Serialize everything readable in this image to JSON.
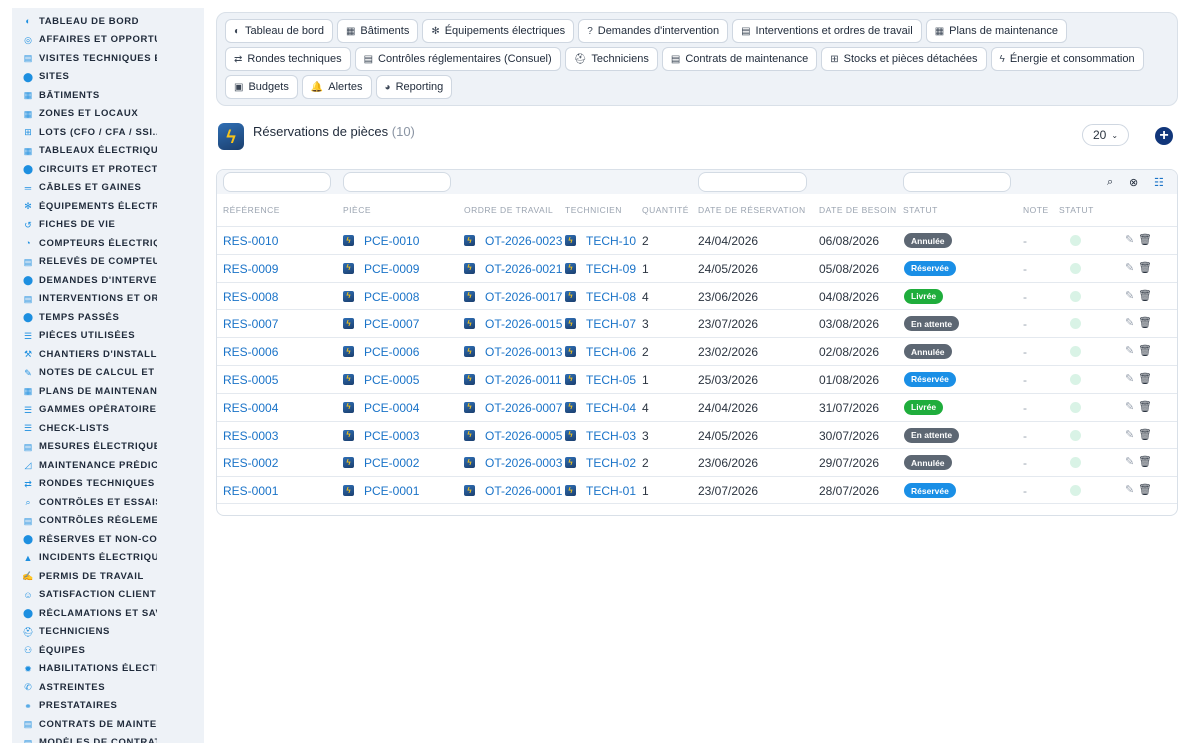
{
  "sidebar": {
    "items": [
      {
        "label": "TABLEAU DE BORD",
        "icon": "dashboard-icon",
        "glyph": "◐"
      },
      {
        "label": "AFFAIRES ET OPPORTUNITÉS",
        "icon": "target-icon",
        "glyph": "◎"
      },
      {
        "label": "VISITES TECHNIQUES ET AUDITS",
        "icon": "clipboard-icon",
        "glyph": "▤"
      },
      {
        "label": "SITES",
        "icon": "map-pin-icon",
        "glyph": "⬤"
      },
      {
        "label": "BÂTIMENTS",
        "icon": "building-icon",
        "glyph": "▦"
      },
      {
        "label": "ZONES ET LOCAUX",
        "icon": "grid-icon",
        "glyph": "▦"
      },
      {
        "label": "LOTS (CFO / CFA / SSI...)",
        "icon": "sitemap-icon",
        "glyph": "⊞"
      },
      {
        "label": "TABLEAUX ÉLECTRIQUES",
        "icon": "panel-icon",
        "glyph": "▦"
      },
      {
        "label": "CIRCUITS ET PROTECTIONS",
        "icon": "circuit-icon",
        "glyph": "⬤"
      },
      {
        "label": "CÂBLES ET GAINES",
        "icon": "cable-icon",
        "glyph": "═"
      },
      {
        "label": "ÉQUIPEMENTS ÉLECTRIQUES",
        "icon": "cogs-icon",
        "glyph": "✻"
      },
      {
        "label": "FICHES DE VIE",
        "icon": "history-icon",
        "glyph": "↺"
      },
      {
        "label": "COMPTEURS ÉLECTRIQUES",
        "icon": "gauge-icon",
        "glyph": "◔"
      },
      {
        "label": "RELEVÉS DE COMPTEURS",
        "icon": "readings-icon",
        "glyph": "▤"
      },
      {
        "label": "DEMANDES D'INTERVENTION",
        "icon": "question-icon",
        "glyph": "⬤"
      },
      {
        "label": "INTERVENTIONS ET ORDRES DE TRAVAIL",
        "icon": "clipboard-check-icon",
        "glyph": "▤"
      },
      {
        "label": "TEMPS PASSÉS",
        "icon": "clock-icon",
        "glyph": "⬤"
      },
      {
        "label": "PIÈCES UTILISÉES",
        "icon": "parts-icon",
        "glyph": "☰"
      },
      {
        "label": "CHANTIERS D'INSTALLATION",
        "icon": "hammer-icon",
        "glyph": "⚒"
      },
      {
        "label": "NOTES DE CALCUL ET ÉTUDES",
        "icon": "calculator-icon",
        "glyph": "✎"
      },
      {
        "label": "PLANS DE MAINTENANCE",
        "icon": "calendar-icon",
        "glyph": "▦"
      },
      {
        "label": "GAMMES OPÉRATOIRES",
        "icon": "list-icon",
        "glyph": "☰"
      },
      {
        "label": "CHECK-LISTS",
        "icon": "checklist-icon",
        "glyph": "☰"
      },
      {
        "label": "MESURES ÉLECTRIQUES",
        "icon": "ruler-icon",
        "glyph": "▤"
      },
      {
        "label": "MAINTENANCE PRÉDICTIVE",
        "icon": "chart-line-icon",
        "glyph": "◿"
      },
      {
        "label": "RONDES TECHNIQUES",
        "icon": "route-icon",
        "glyph": "⇄"
      },
      {
        "label": "CONTRÔLES ET ESSAIS",
        "icon": "search-icon",
        "glyph": "⌕"
      },
      {
        "label": "CONTRÔLES RÉGLEMENTAIRES",
        "icon": "file-check-icon",
        "glyph": "▤"
      },
      {
        "label": "RÉSERVES ET NON-CONFORMITÉS",
        "icon": "alert-circle-icon",
        "glyph": "⬤"
      },
      {
        "label": "INCIDENTS ÉLECTRIQUES",
        "icon": "warning-icon",
        "glyph": "▲"
      },
      {
        "label": "PERMIS DE TRAVAIL",
        "icon": "signature-icon",
        "glyph": "✍"
      },
      {
        "label": "SATISFACTION CLIENT",
        "icon": "smile-icon",
        "glyph": "☺"
      },
      {
        "label": "RÉCLAMATIONS ET SAV",
        "icon": "comment-icon",
        "glyph": "⬤"
      },
      {
        "label": "TECHNICIENS",
        "icon": "hard-hat-icon",
        "glyph": "⛑"
      },
      {
        "label": "ÉQUIPES",
        "icon": "users-icon",
        "glyph": "⚇"
      },
      {
        "label": "HABILITATIONS ÉLECTRIQUES",
        "icon": "certificate-icon",
        "glyph": "✹"
      },
      {
        "label": "ASTREINTES",
        "icon": "phone-icon",
        "glyph": "✆"
      },
      {
        "label": "PRESTATAIRES",
        "icon": "handshake-icon",
        "glyph": "⚭"
      },
      {
        "label": "CONTRATS DE MAINTENANCE",
        "icon": "contract-icon",
        "glyph": "▤"
      },
      {
        "label": "MODÈLES DE CONTRATS",
        "icon": "file-icon",
        "glyph": "▤"
      }
    ]
  },
  "topnav": {
    "buttons": [
      {
        "label": "Tableau de bord",
        "icon": "dashboard-icon",
        "glyph": "◐"
      },
      {
        "label": "Bâtiments",
        "icon": "building-icon",
        "glyph": "▦"
      },
      {
        "label": "Équipements électriques",
        "icon": "cogs-icon",
        "glyph": "✻"
      },
      {
        "label": "Demandes d'intervention",
        "icon": "question-icon",
        "glyph": "?"
      },
      {
        "label": "Interventions et ordres de travail",
        "icon": "clipboard-check-icon",
        "glyph": "▤"
      },
      {
        "label": "Plans de maintenance",
        "icon": "calendar-icon",
        "glyph": "▦"
      },
      {
        "label": "Rondes techniques",
        "icon": "route-icon",
        "glyph": "⇄"
      },
      {
        "label": "Contrôles réglementaires (Consuel)",
        "icon": "file-check-icon",
        "glyph": "▤"
      },
      {
        "label": "Techniciens",
        "icon": "hard-hat-icon",
        "glyph": "⛑"
      },
      {
        "label": "Contrats de maintenance",
        "icon": "contract-icon",
        "glyph": "▤"
      },
      {
        "label": "Stocks et pièces détachées",
        "icon": "boxes-icon",
        "glyph": "⊞"
      },
      {
        "label": "Énergie et consommation",
        "icon": "bolt-icon",
        "glyph": "ϟ"
      },
      {
        "label": "Budgets",
        "icon": "money-icon",
        "glyph": "▣"
      },
      {
        "label": "Alertes",
        "icon": "bell-icon",
        "glyph": "🔔"
      },
      {
        "label": "Reporting",
        "icon": "pie-chart-icon",
        "glyph": "◕"
      }
    ]
  },
  "header": {
    "title": "Réservations de pièces",
    "count": "(10)",
    "page_size": "20",
    "page_size_chevron": "⌄",
    "add_glyph": "+",
    "logo_glyph": "ϟ"
  },
  "table": {
    "toolbar_icons": [
      {
        "icon": "search-icon",
        "glyph": "⌕"
      },
      {
        "icon": "filter-clear-icon",
        "glyph": "⊗"
      },
      {
        "icon": "column-list-icon",
        "glyph": "☷"
      }
    ],
    "columns": [
      "Référence",
      "Pièce",
      "Ordre de travail",
      "Technicien",
      "Quantité",
      "Date de réservation",
      "Date de besoin",
      "Statut",
      "Note",
      "Statut"
    ],
    "rows": [
      {
        "ref": "RES-0010",
        "piece": "PCE-0010",
        "ot": "OT-2026-0023",
        "tech": "TECH-10",
        "qty": "2",
        "date_res": "24/04/2026",
        "date_besoin": "06/08/2026",
        "statut": "Annulée",
        "statut_color": "#5d6773",
        "note": "-"
      },
      {
        "ref": "RES-0009",
        "piece": "PCE-0009",
        "ot": "OT-2026-0021",
        "tech": "TECH-09",
        "qty": "1",
        "date_res": "24/05/2026",
        "date_besoin": "05/08/2026",
        "statut": "Réservée",
        "statut_color": "#1a8fe6",
        "note": "-"
      },
      {
        "ref": "RES-0008",
        "piece": "PCE-0008",
        "ot": "OT-2026-0017",
        "tech": "TECH-08",
        "qty": "4",
        "date_res": "23/06/2026",
        "date_besoin": "04/08/2026",
        "statut": "Livrée",
        "statut_color": "#1fad3c",
        "note": "-"
      },
      {
        "ref": "RES-0007",
        "piece": "PCE-0007",
        "ot": "OT-2026-0015",
        "tech": "TECH-07",
        "qty": "3",
        "date_res": "23/07/2026",
        "date_besoin": "03/08/2026",
        "statut": "En attente",
        "statut_color": "#5d6773",
        "note": "-"
      },
      {
        "ref": "RES-0006",
        "piece": "PCE-0006",
        "ot": "OT-2026-0013",
        "tech": "TECH-06",
        "qty": "2",
        "date_res": "23/02/2026",
        "date_besoin": "02/08/2026",
        "statut": "Annulée",
        "statut_color": "#5d6773",
        "note": "-"
      },
      {
        "ref": "RES-0005",
        "piece": "PCE-0005",
        "ot": "OT-2026-0011",
        "tech": "TECH-05",
        "qty": "1",
        "date_res": "25/03/2026",
        "date_besoin": "01/08/2026",
        "statut": "Réservée",
        "statut_color": "#1a8fe6",
        "note": "-"
      },
      {
        "ref": "RES-0004",
        "piece": "PCE-0004",
        "ot": "OT-2026-0007",
        "tech": "TECH-04",
        "qty": "4",
        "date_res": "24/04/2026",
        "date_besoin": "31/07/2026",
        "statut": "Livrée",
        "statut_color": "#1fad3c",
        "note": "-"
      },
      {
        "ref": "RES-0003",
        "piece": "PCE-0003",
        "ot": "OT-2026-0005",
        "tech": "TECH-03",
        "qty": "3",
        "date_res": "24/05/2026",
        "date_besoin": "30/07/2026",
        "statut": "En attente",
        "statut_color": "#5d6773",
        "note": "-"
      },
      {
        "ref": "RES-0002",
        "piece": "PCE-0002",
        "ot": "OT-2026-0003",
        "tech": "TECH-02",
        "qty": "2",
        "date_res": "23/06/2026",
        "date_besoin": "29/07/2026",
        "statut": "Annulée",
        "statut_color": "#5d6773",
        "note": "-"
      },
      {
        "ref": "RES-0001",
        "piece": "PCE-0001",
        "ot": "OT-2026-0001",
        "tech": "TECH-01",
        "qty": "1",
        "date_res": "23/07/2026",
        "date_besoin": "28/07/2026",
        "statut": "Réservée",
        "statut_color": "#1a8fe6",
        "note": "-"
      }
    ],
    "row_actions": {
      "edit_glyph": "✎",
      "delete_glyph": "🗑"
    },
    "mini_logo_glyph": "ϟ"
  },
  "colors": {
    "accent": "#1a73c8",
    "add_button": "#11367a",
    "sidebar_bg": "#eef2f7",
    "status_cancelled": "#5d6773",
    "status_reserved": "#1a8fe6",
    "status_delivered": "#1fad3c"
  }
}
